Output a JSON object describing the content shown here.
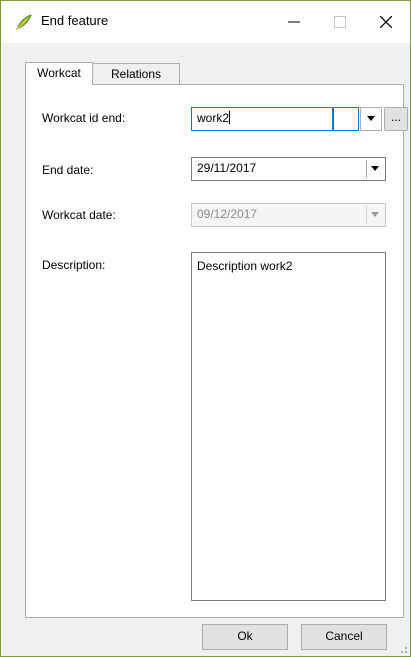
{
  "window": {
    "title": "End feature",
    "icon": "qgis-leaf-icon",
    "controls": [
      "minimize-icon",
      "maximize-icon",
      "close-icon"
    ]
  },
  "tabs": [
    {
      "label": "Workcat",
      "active": true
    },
    {
      "label": "Relations",
      "active": false
    }
  ],
  "form": {
    "workcat_id_end": {
      "label": "Workcat id end:",
      "value": "work2",
      "browse_label": "..."
    },
    "end_date": {
      "label": "End date:",
      "value": "29/11/2017"
    },
    "workcat_date": {
      "label": "Workcat date:",
      "value": "09/12/2017",
      "enabled": false
    },
    "description": {
      "label": "Description:",
      "value": "Description work2"
    }
  },
  "buttons": {
    "ok": "Ok",
    "cancel": "Cancel"
  },
  "colors": {
    "focus_border": "#0078d7",
    "window_border": "#7a9c3a"
  }
}
